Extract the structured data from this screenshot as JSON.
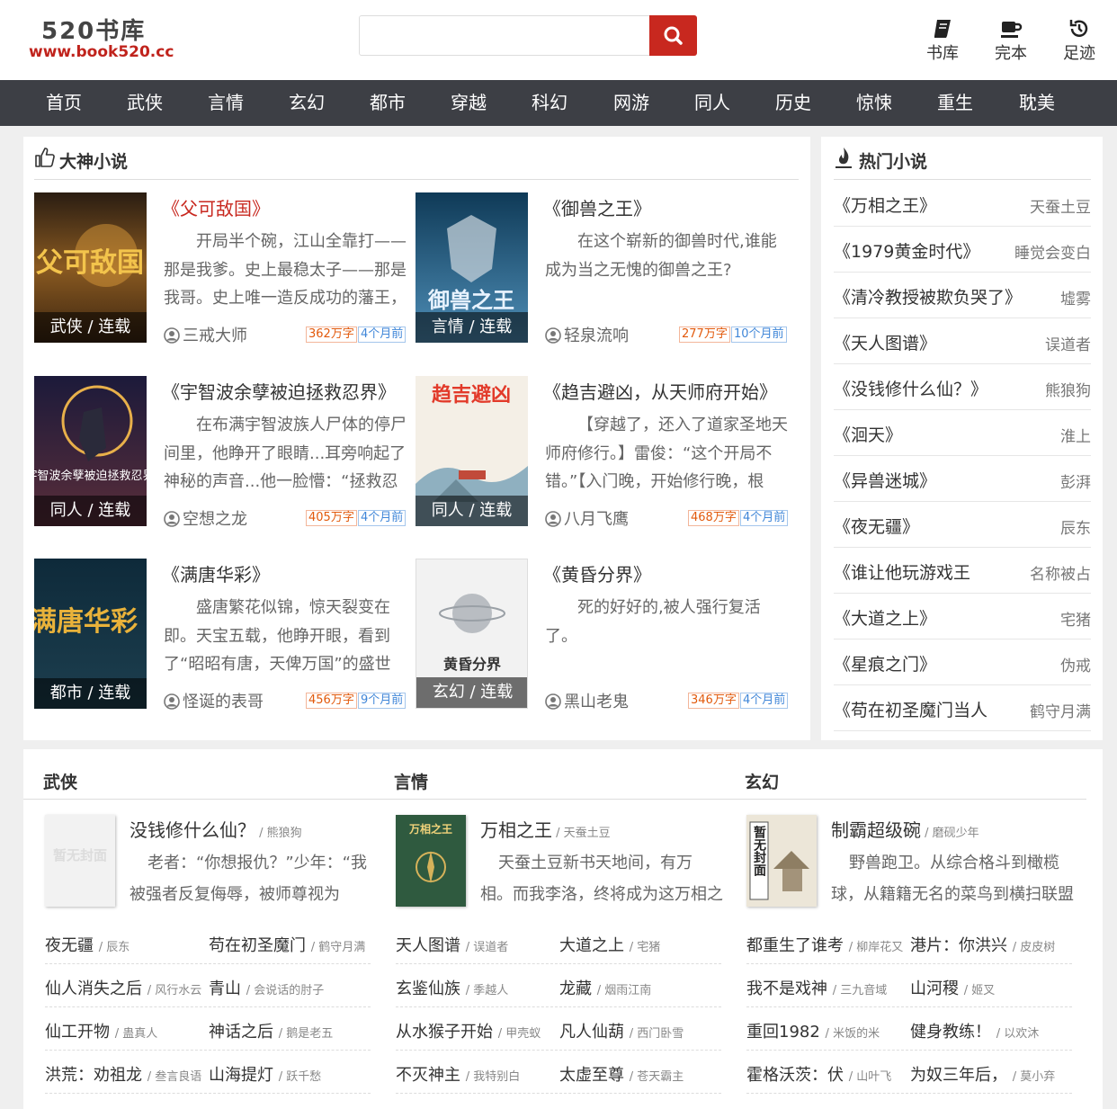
{
  "header": {
    "logo_name": "520书库",
    "logo_url": "www.book520.cc",
    "search_placeholder": "",
    "quick_links": [
      {
        "label": "书库",
        "icon": "book-icon"
      },
      {
        "label": "完本",
        "icon": "coffee-cup-icon"
      },
      {
        "label": "足迹",
        "icon": "history-icon"
      }
    ]
  },
  "nav": [
    "首页",
    "武侠",
    "言情",
    "玄幻",
    "都市",
    "穿越",
    "科幻",
    "网游",
    "同人",
    "历史",
    "惊悚",
    "重生",
    "耽美"
  ],
  "featured": {
    "heading": "大神小说",
    "books": [
      {
        "title": "《父可敌国》",
        "tag": "武侠 / 连载",
        "intro": "开局半个碗，江山全靠打——那是我爹。史上最稳太子——那是我哥。史上唯一造反成功的藩王，",
        "author": "三戒大师",
        "words": "362万字",
        "time": "4个月前",
        "cover_text": "父可敌国"
      },
      {
        "title": "《御兽之王》",
        "tag": "言情 / 连载",
        "intro": "在这个崭新的御兽时代,谁能成为当之无愧的御兽之王?",
        "author": "轻泉流响",
        "words": "277万字",
        "time": "10个月前",
        "cover_text": "御兽之王"
      },
      {
        "title": "《宇智波余孽被迫拯救忍界》",
        "tag": "同人 / 连载",
        "intro": "在布满宇智波族人尸体的停尸间里，他睁开了眼睛...耳旁响起了神秘的声音...他一脸懵：“拯救忍",
        "author": "空想之龙",
        "words": "405万字",
        "time": "4个月前",
        "cover_text": "宇智波余孽被迫拯救忍界"
      },
      {
        "title": "《趋吉避凶，从天师府开始》",
        "tag": "同人 / 连载",
        "intro": "【穿越了，还入了道家圣地天师府修行。】雷俊：“这个开局不错。”【入门晚，开始修行晚，根",
        "author": "八月飞鹰",
        "words": "468万字",
        "time": "4个月前",
        "cover_text": "趋吉避凶"
      },
      {
        "title": "《满唐华彩》",
        "tag": "都市 / 连载",
        "intro": "盛唐繁花似锦，惊天裂变在即。天宝五载，他睁开眼，看到了“昭昭有唐，天俾万国”的盛世雄",
        "author": "怪诞的表哥",
        "words": "456万字",
        "time": "9个月前",
        "cover_text": "满唐华彩"
      },
      {
        "title": "《黄昏分界》",
        "tag": "玄幻 / 连载",
        "intro": "死的好好的,被人强行复活了。",
        "author": "黑山老鬼",
        "words": "346万字",
        "time": "4个月前",
        "cover_text": "黄昏分界"
      }
    ]
  },
  "hot": {
    "heading": "热门小说",
    "items": [
      {
        "title": "《万相之王》",
        "author": "天蚕土豆"
      },
      {
        "title": "《1979黄金时代》",
        "author": "睡觉会变白"
      },
      {
        "title": "《清冷教授被欺负哭了》",
        "author": "墟雾"
      },
      {
        "title": "《天人图谱》",
        "author": "误道者"
      },
      {
        "title": "《没钱修什么仙？》",
        "author": "熊狼狗"
      },
      {
        "title": "《洄天》",
        "author": "淮上"
      },
      {
        "title": "《异兽迷城》",
        "author": "彭湃"
      },
      {
        "title": "《夜无疆》",
        "author": "辰东"
      },
      {
        "title": "《谁让他玩游戏王",
        "author": "名称被占"
      },
      {
        "title": "《大道之上》",
        "author": "宅猪"
      },
      {
        "title": "《星痕之门》",
        "author": "伪戒"
      },
      {
        "title": "《苟在初圣魔门当人",
        "author": "鹤守月满"
      }
    ]
  },
  "categories": [
    {
      "name": "武侠",
      "feature": {
        "title": "没钱修什么仙？",
        "author": "熊狼狗",
        "intro": "老者：“你想报仇？”少年：“我被强者反复侮辱，被师尊视为",
        "cover_text": "暂无封面"
      },
      "list": [
        {
          "title": "夜无疆",
          "author": "辰东"
        },
        {
          "title": "苟在初圣魔门",
          "author": "鹤守月满"
        },
        {
          "title": "仙人消失之后",
          "author": "风行水云"
        },
        {
          "title": "青山",
          "author": "会说话的肘子"
        },
        {
          "title": "仙工开物",
          "author": "蛊真人"
        },
        {
          "title": "神话之后",
          "author": "鹅是老五"
        },
        {
          "title": "洪荒：劝祖龙",
          "author": "叁言良语"
        },
        {
          "title": "山海提灯",
          "author": "跃千愁"
        }
      ]
    },
    {
      "name": "言情",
      "feature": {
        "title": "万相之王",
        "author": "天蚕土豆",
        "intro": "天蚕土豆新书天地间，有万相。而我李洛，终将成为这万相之王。",
        "cover_text": "万相之王"
      },
      "list": [
        {
          "title": "天人图谱",
          "author": "误道者"
        },
        {
          "title": "大道之上",
          "author": "宅猪"
        },
        {
          "title": "玄鉴仙族",
          "author": "季越人"
        },
        {
          "title": "龙藏",
          "author": "烟雨江南"
        },
        {
          "title": "从水猴子开始",
          "author": "甲壳蚁"
        },
        {
          "title": "凡人仙葫",
          "author": "西门卧雪"
        },
        {
          "title": "不灭神主",
          "author": "我特别白"
        },
        {
          "title": "太虚至尊",
          "author": "苍天霸主"
        }
      ]
    },
    {
      "name": "玄幻",
      "feature": {
        "title": "制霸超级碗",
        "author": "磨砚少年",
        "intro": "野兽跑卫。从综合格斗到橄榄球，从籍籍无名的菜鸟到横扫联盟",
        "cover_text": "暂无封面"
      },
      "list": [
        {
          "title": "都重生了谁考",
          "author": "柳岸花又"
        },
        {
          "title": "港片：你洪兴",
          "author": "皮皮树"
        },
        {
          "title": "我不是戏神",
          "author": "三九音域"
        },
        {
          "title": "山河稷",
          "author": "姬叉"
        },
        {
          "title": "重回1982",
          "author": "米饭的米"
        },
        {
          "title": "健身教练！",
          "author": "以欢沐"
        },
        {
          "title": "霍格沃茨：伏",
          "author": "山叶飞"
        },
        {
          "title": "为奴三年后，",
          "author": "莫小弃"
        }
      ]
    }
  ],
  "colors": {
    "accent": "#c8281f",
    "nav_bg": "#3d3f45",
    "words_badge": "#e2590b",
    "time_badge": "#3f86d8"
  }
}
